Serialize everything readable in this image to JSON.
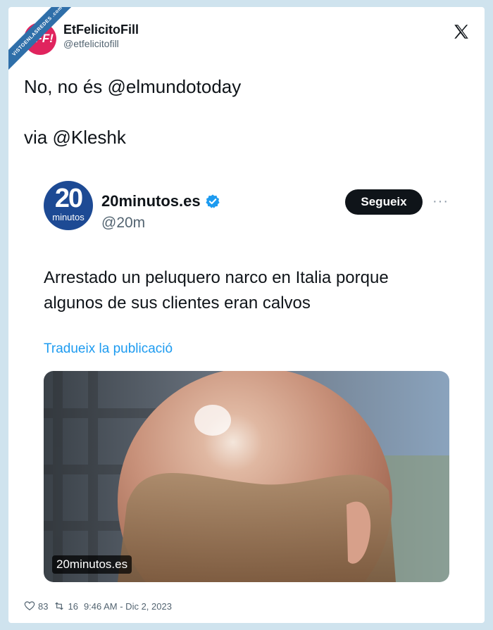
{
  "watermark": {
    "text": "VISTOENLASREDES .com"
  },
  "tweet": {
    "author": {
      "avatar_text": "EFF!",
      "name": "EtFelicitoFill",
      "handle": "@etfelicitofill"
    },
    "close_icon": "x-logo-icon",
    "lines": [
      "No, no és @elmundotoday",
      "via @Kleshk"
    ],
    "embed": {
      "logo_number": "20",
      "logo_word": "minutos",
      "name": "20minutos.es",
      "handle": "@20m",
      "verified_icon": "verified-badge-icon",
      "follow_label": "Segueix",
      "more_icon": "···",
      "text": "Arrestado un peluquero narco en Italia porque algunos de sus clientes eran calvos",
      "translate_label": "Tradueix la publicació",
      "media_label": "20minutos.es"
    },
    "stats": {
      "likes": "83",
      "retweets": "16",
      "timestamp": "9:46 AM - Dic 2, 2023"
    }
  },
  "colors": {
    "background": "#cfe3ee",
    "avatar": "#e0245e",
    "logo": "#1d4a94",
    "link": "#1d9bf0",
    "verified": "#1d9bf0"
  }
}
